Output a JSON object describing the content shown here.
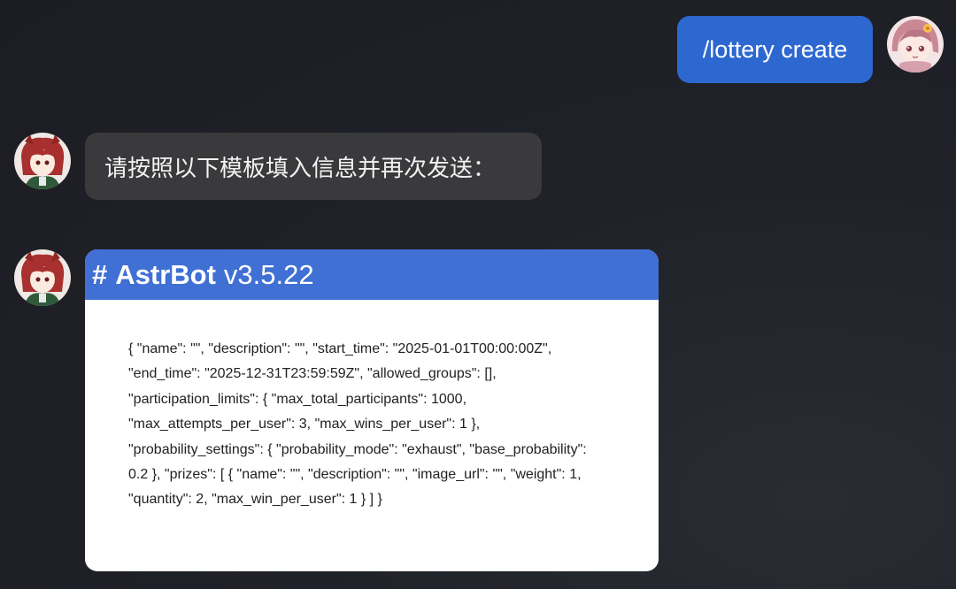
{
  "messages": {
    "user_command": "/lottery create",
    "bot_prompt": "请按照以下模板填入信息并再次发送：",
    "card": {
      "hash": "#",
      "brand": "AstrBot",
      "version": "v3.5.22",
      "lines": [
        "{ \"name\": \"\", \"description\": \"\", \"start_time\": \"2025-01-01T00:00:00Z\",",
        "\"end_time\": \"2025-12-31T23:59:59Z\", \"allowed_groups\": [],",
        "\"participation_limits\": { \"max_total_participants\": 1000,",
        "\"max_attempts_per_user\": 3, \"max_wins_per_user\": 1 },",
        "\"probability_settings\": { \"probability_mode\": \"exhaust\", \"base_probability\":",
        "0.2 }, \"prizes\": [ { \"name\": \"\", \"description\": \"\", \"image_url\": \"\", \"weight\": 1,",
        "\"quantity\": 2, \"max_win_per_user\": 1 } ] }"
      ]
    }
  },
  "colors": {
    "user_bubble": "#2d67d0",
    "bot_bubble": "#3a3a3d",
    "card_header": "#4070d4",
    "background": "#202229"
  },
  "icons": {
    "user_avatar": "user-avatar-icon",
    "bot_avatar": "bot-avatar-icon"
  }
}
